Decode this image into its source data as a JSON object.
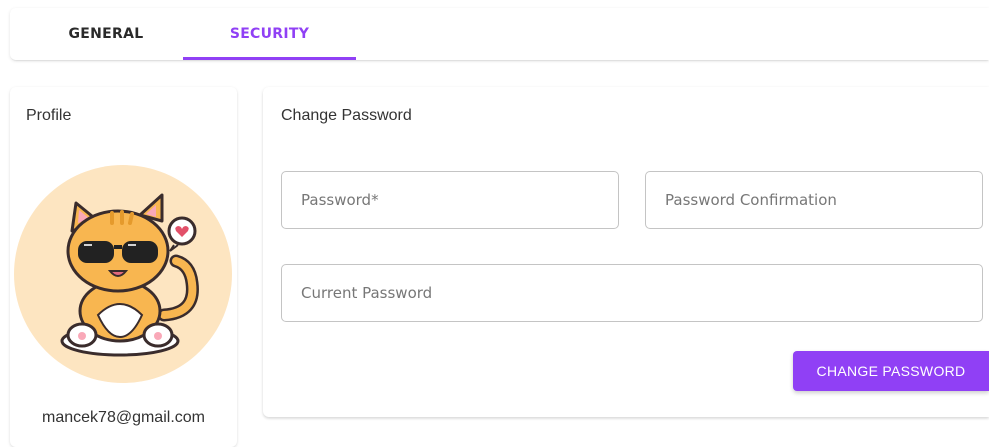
{
  "tabs": [
    {
      "label": "GENERAL",
      "active": false
    },
    {
      "label": "SECURITY",
      "active": true
    }
  ],
  "colors": {
    "accent": "#9040f5",
    "avatar_bg": "#fde5c1"
  },
  "profile": {
    "title": "Profile",
    "avatar_icon": "cat-with-sunglasses-avatar",
    "email": "mancek78@gmail.com"
  },
  "change_password": {
    "title": "Change Password",
    "password_placeholder": "Password*",
    "confirmation_placeholder": "Password Confirmation",
    "current_placeholder": "Current Password",
    "submit_label": "CHANGE PASSWORD"
  }
}
